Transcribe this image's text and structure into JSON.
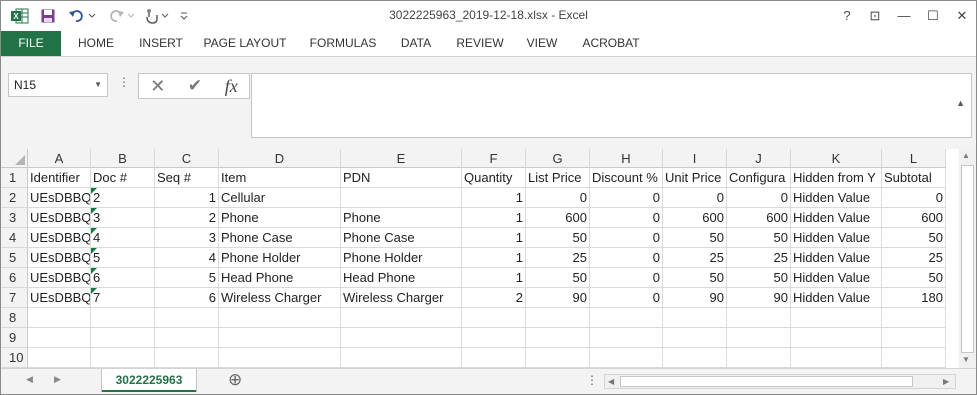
{
  "window": {
    "title": "3022225963_2019-12-18.xlsx - Excel",
    "help": "?",
    "ribbon_display": "⊡",
    "minimize": "—",
    "maximize": "☐",
    "close": "✕"
  },
  "quick_access": [
    "excel-logo-icon",
    "save-icon",
    "undo-icon",
    "redo-icon",
    "touch-mode-icon",
    "customize-qat-icon"
  ],
  "ribbon": {
    "tabs": [
      "FILE",
      "HOME",
      "INSERT",
      "PAGE LAYOUT",
      "FORMULAS",
      "DATA",
      "REVIEW",
      "VIEW",
      "ACROBAT"
    ]
  },
  "formula_bar": {
    "name_box": "N15",
    "dots": "⋮",
    "cancel": "✕",
    "enter": "✔",
    "fx": "fx",
    "value": ""
  },
  "colors": {
    "accent": "#217346",
    "text_indicator": "#107c41"
  },
  "grid": {
    "columns": [
      "A",
      "B",
      "C",
      "D",
      "E",
      "F",
      "G",
      "H",
      "I",
      "J",
      "K",
      "L"
    ],
    "row_numbers": [
      "1",
      "2",
      "3",
      "4",
      "5",
      "6",
      "7",
      "8",
      "9",
      "10"
    ],
    "rows": [
      [
        "Identifier",
        "Doc #",
        "Seq #",
        "Item",
        "PDN",
        "Quantity",
        "List Price",
        "Discount %",
        "Unit Price",
        "Configura",
        "Hidden from Y",
        "Subtotal"
      ],
      [
        "UEsDBBQA",
        "2",
        "1",
        "Cellular",
        "",
        "1",
        "0",
        "0",
        "0",
        "0",
        "Hidden Value",
        "0"
      ],
      [
        "UEsDBBQA",
        "3",
        "2",
        "Phone",
        "Phone",
        "1",
        "600",
        "0",
        "600",
        "600",
        "Hidden Value",
        "600"
      ],
      [
        "UEsDBBQA",
        "4",
        "3",
        "Phone Case",
        "Phone Case",
        "1",
        "50",
        "0",
        "50",
        "50",
        "Hidden Value",
        "50"
      ],
      [
        "UEsDBBQA",
        "5",
        "4",
        "Phone Holder",
        "Phone Holder",
        "1",
        "25",
        "0",
        "25",
        "25",
        "Hidden Value",
        "25"
      ],
      [
        "UEsDBBQA",
        "6",
        "5",
        "Head Phone",
        "Head Phone",
        "1",
        "50",
        "0",
        "50",
        "50",
        "Hidden Value",
        "50"
      ],
      [
        "UEsDBBQA",
        "7",
        "6",
        "Wireless Charger",
        "Wireless Charger",
        "2",
        "90",
        "0",
        "90",
        "90",
        "Hidden Value",
        "180"
      ],
      [
        "",
        "",
        "",
        "",
        "",
        "",
        "",
        "",
        "",
        "",
        "",
        ""
      ],
      [
        "",
        "",
        "",
        "",
        "",
        "",
        "",
        "",
        "",
        "",
        "",
        ""
      ],
      [
        "",
        "",
        "",
        "",
        "",
        "",
        "",
        "",
        "",
        "",
        "",
        ""
      ]
    ],
    "numeric_columns": [
      2,
      5,
      6,
      7,
      8,
      9,
      11
    ],
    "text_number_column": 1
  },
  "sheets": {
    "active": "3022225963",
    "add_sheet": "⊕",
    "nav_prev": "◀",
    "nav_next": "▶",
    "split_dots": "⋮"
  }
}
